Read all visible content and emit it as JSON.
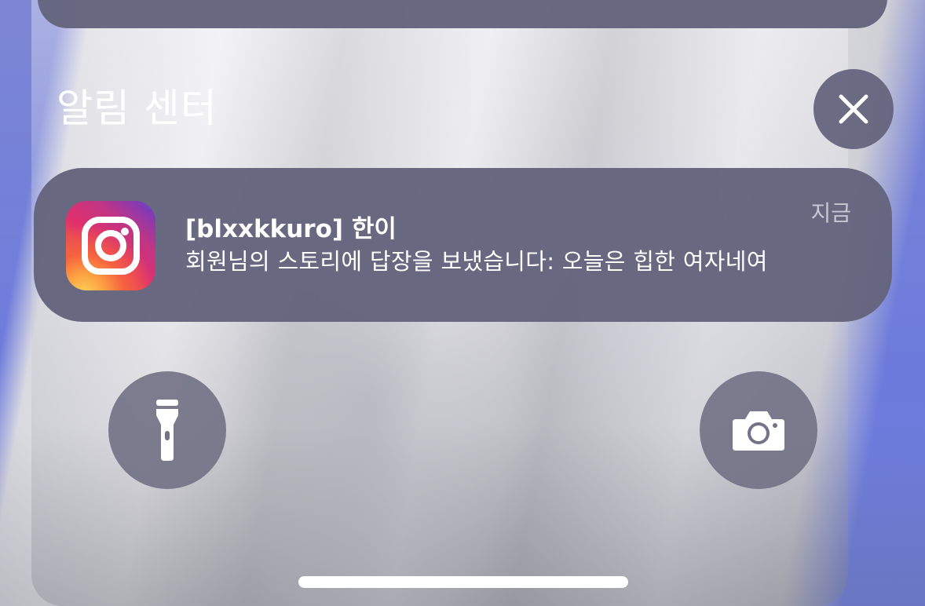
{
  "notification_center": {
    "title": "알림 센터",
    "close_icon": "close-icon"
  },
  "notifications": [
    {
      "app_icon": "instagram-icon",
      "title": "[blxxkkuro] 한이",
      "body": "회원님의 스토리에 답장을 보냈습니다: 오늘은 힙한 여자네여",
      "time": "지금"
    }
  ],
  "quick_actions": {
    "flashlight_icon": "flashlight-icon",
    "camera_icon": "camera-icon"
  },
  "colors": {
    "card_background": "#64647d",
    "button_background": "#737387",
    "wallpaper_blue": "#6f80e0",
    "text": "#ffffff"
  }
}
